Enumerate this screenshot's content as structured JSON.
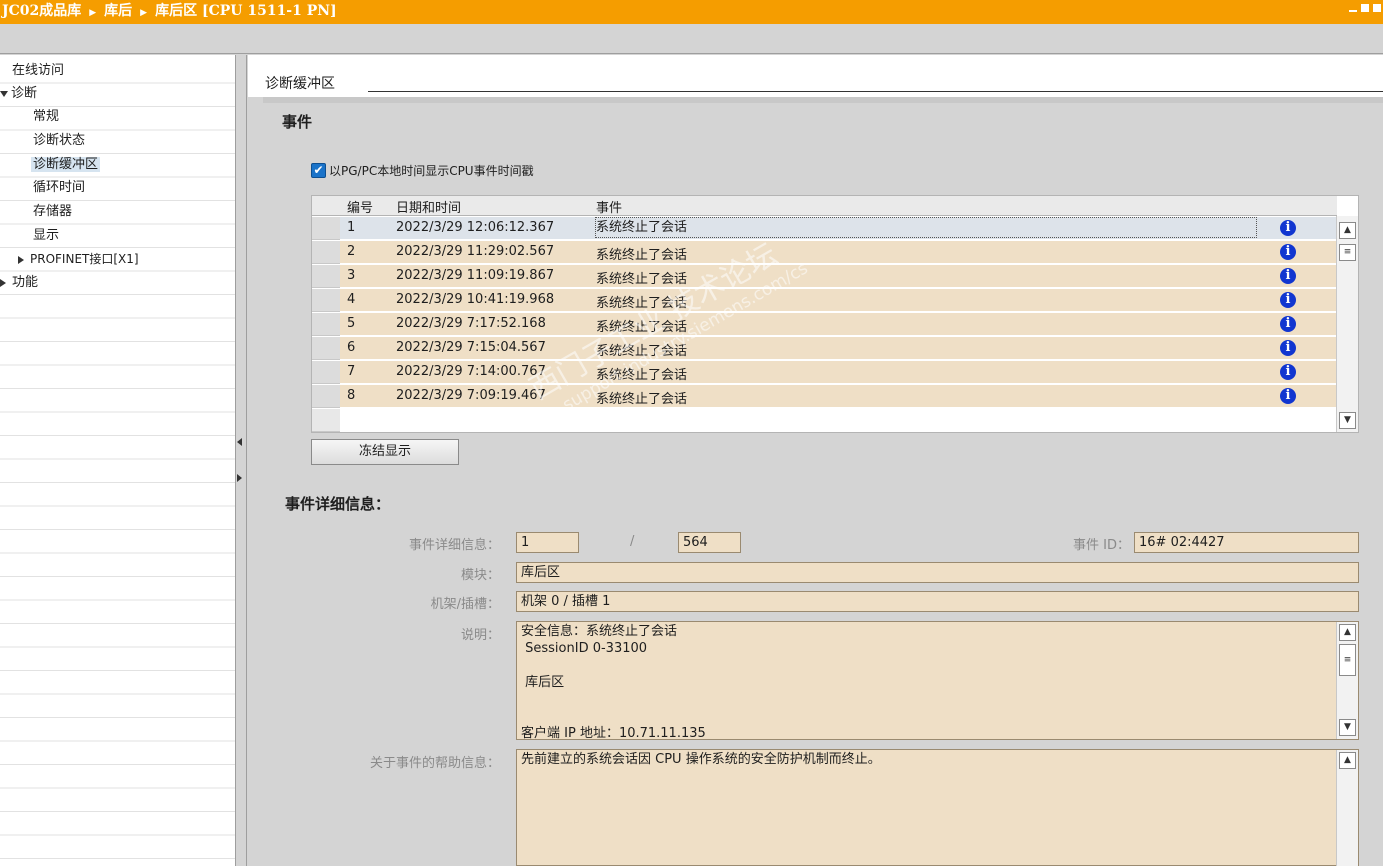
{
  "titlebar": {
    "crumbs": [
      "JC02成品库",
      "库后",
      "库后区 [CPU 1511-1 PN]"
    ]
  },
  "sidebar": {
    "items": [
      {
        "label": "在线访问"
      },
      {
        "label": "诊断"
      },
      {
        "label": "常规"
      },
      {
        "label": "诊断状态"
      },
      {
        "label": "诊断缓冲区"
      },
      {
        "label": "循环时间"
      },
      {
        "label": "存储器"
      },
      {
        "label": "显示"
      },
      {
        "label": "PROFINET接口[X1]"
      },
      {
        "label": "功能"
      }
    ]
  },
  "main": {
    "section_title": "诊断缓冲区",
    "events_heading": "事件",
    "checkbox_label": "以PG/PC本地时间显示CPU事件时间戳",
    "checkbox_checked": "✔",
    "table": {
      "headers": [
        "编号",
        "日期和时间",
        "事件"
      ],
      "rows": [
        {
          "num": "1",
          "datetime": "2022/3/29 12:06:12.367",
          "event": "系统终止了会话"
        },
        {
          "num": "2",
          "datetime": "2022/3/29 11:29:02.567",
          "event": "系统终止了会话"
        },
        {
          "num": "3",
          "datetime": "2022/3/29 11:09:19.867",
          "event": "系统终止了会话"
        },
        {
          "num": "4",
          "datetime": "2022/3/29 10:41:19.968",
          "event": "系统终止了会话"
        },
        {
          "num": "5",
          "datetime": "2022/3/29 7:17:52.168",
          "event": "系统终止了会话"
        },
        {
          "num": "6",
          "datetime": "2022/3/29 7:15:04.567",
          "event": "系统终止了会话"
        },
        {
          "num": "7",
          "datetime": "2022/3/29 7:14:00.767",
          "event": "系统终止了会话"
        },
        {
          "num": "8",
          "datetime": "2022/3/29 7:09:19.467",
          "event": "系统终止了会话"
        }
      ],
      "info_glyph": "i"
    },
    "freeze_button": "冻结显示",
    "details_heading": "事件详细信息：",
    "details": {
      "detail_label": "事件详细信息：",
      "detail_value": "1",
      "detail_sep": "/",
      "detail_total": "564",
      "event_id_label": "事件 ID：",
      "event_id_value": "16# 02:4427",
      "module_label": "模块：",
      "module_value": "库后区",
      "rack_label": "机架/插槽：",
      "rack_value": "机架 0 / 插槽 1",
      "desc_label": "说明：",
      "desc_value": "安全信息：系统终止了会话\n SessionID 0-33100\n\n 库后区\n\n\n客户端 IP 地址：10.71.11.135",
      "help_label": "关于事件的帮助信息：",
      "help_value": "先前建立的系统会话因 CPU 操作系统的安全防护机制而终止。"
    }
  },
  "watermark": {
    "line1": "西门子工业 技术论坛",
    "line2": "support.industry.siemens.com/cs"
  },
  "colors": {
    "titlebar": "#f59d00",
    "row_bg": "#efdfc6",
    "info_icon": "#1136d0"
  }
}
